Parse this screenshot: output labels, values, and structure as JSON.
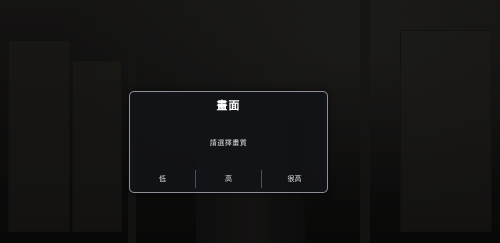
{
  "dialog": {
    "title": "畫面",
    "message": "請選擇畫質",
    "options": [
      {
        "label": "低"
      },
      {
        "label": "高"
      },
      {
        "label": "很高"
      }
    ]
  },
  "colors": {
    "dialog_background": "#121318",
    "dialog_border": "#8d9099",
    "text": "#ffffff"
  }
}
